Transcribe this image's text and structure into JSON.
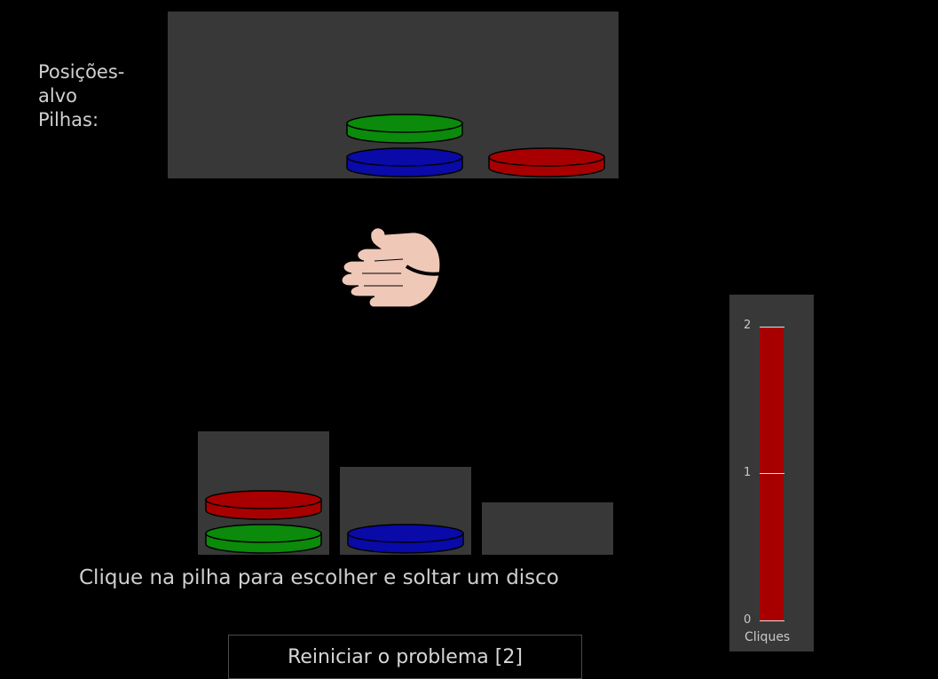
{
  "goal": {
    "label": "Posições-\nalvo\nPilhas:",
    "pegs": [
      [],
      [
        "blue",
        "green"
      ],
      [
        "red"
      ]
    ]
  },
  "current": {
    "pegs": [
      [
        "green",
        "red"
      ],
      [
        "blue"
      ],
      []
    ]
  },
  "instruction": "Clique na pilha para escolher e soltar um disco",
  "reset_button": {
    "label": "Reiniciar o problema [2]"
  },
  "clicks": {
    "caption": "Cliques",
    "max": 2,
    "value": 2,
    "ticks": [
      "0",
      "1",
      "2"
    ]
  },
  "colors": {
    "green": "#0b8a0b",
    "blue": "#0a0aa8",
    "red": "#a80000",
    "panel": "#383838",
    "hand": "#f0c8b8"
  },
  "icons": {
    "hand": "open-hand-icon"
  }
}
